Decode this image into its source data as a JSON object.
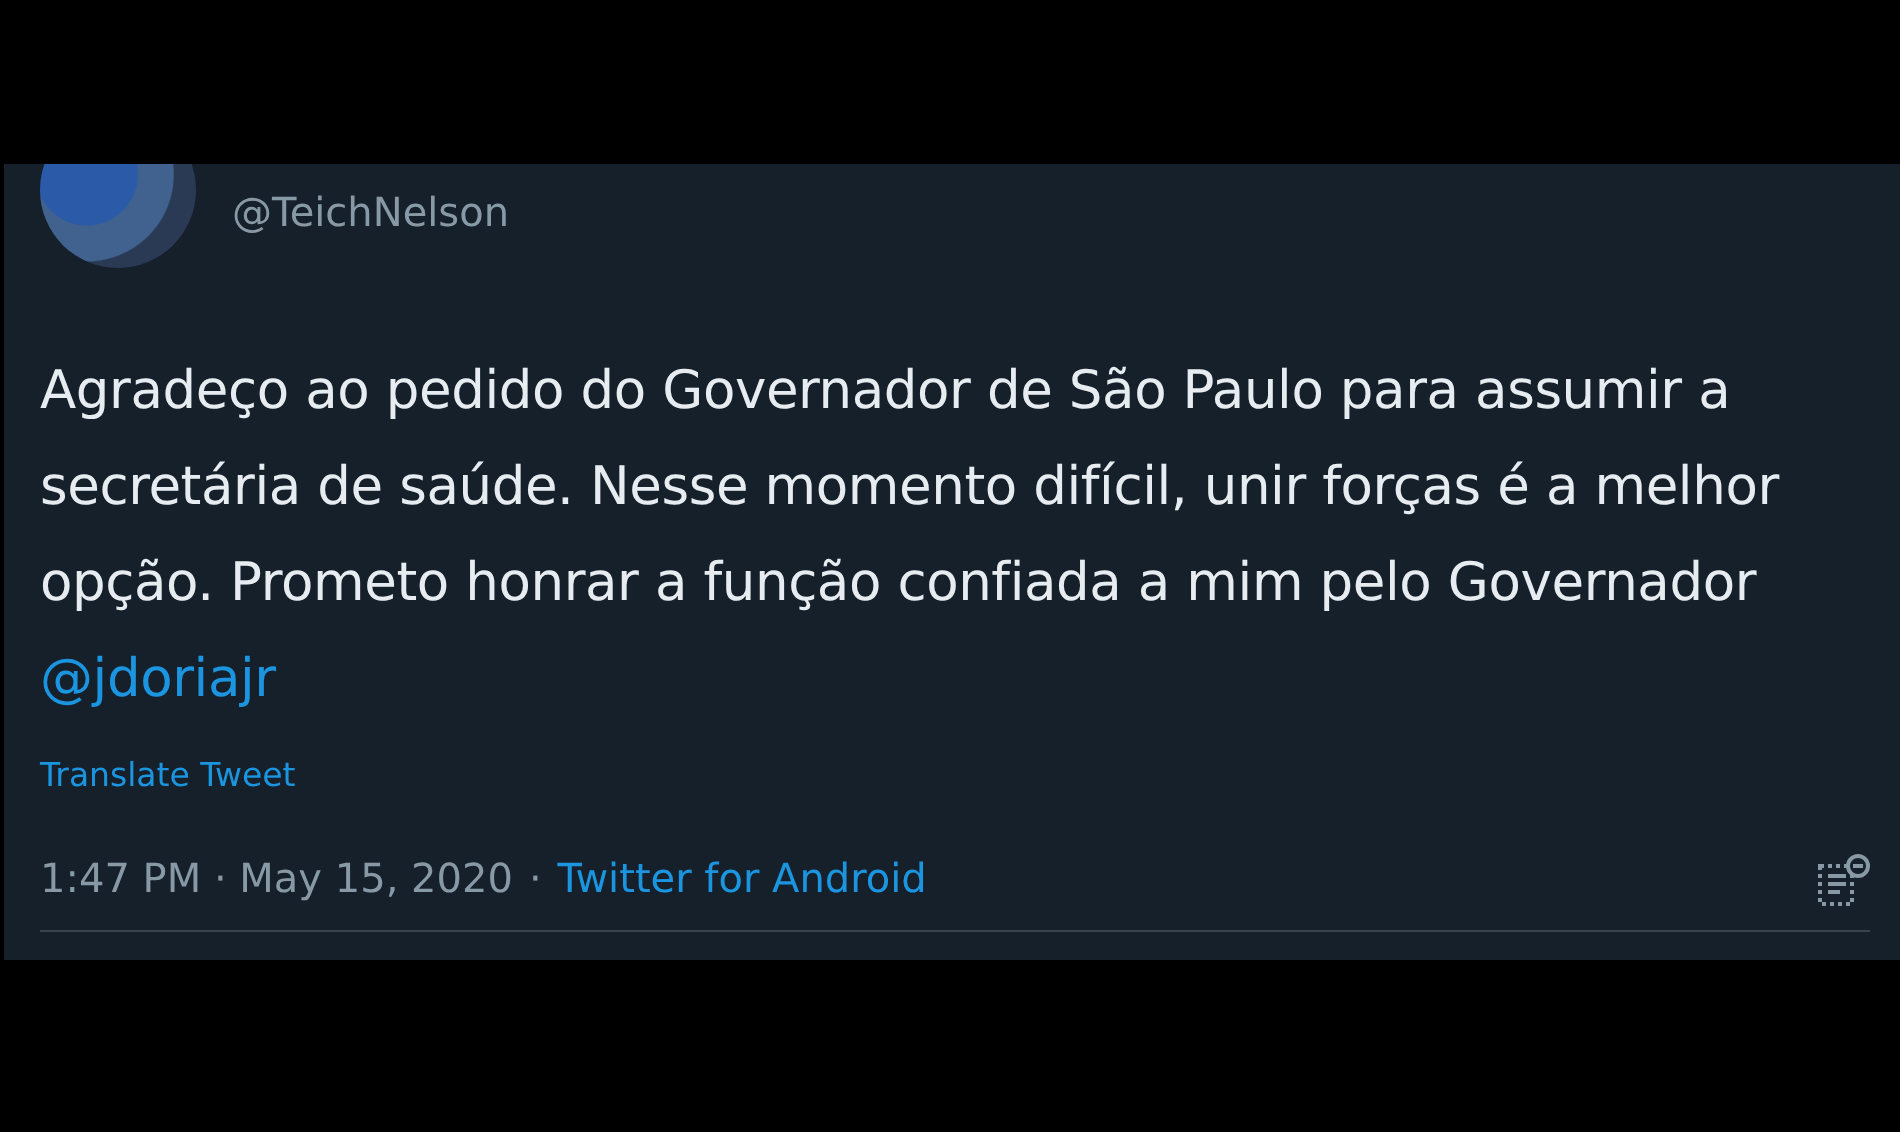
{
  "tweet": {
    "handle": "@TeichNelson",
    "text": "Agradeço ao pedido do Governador de São Paulo para assumir a secretária de saúde. Nesse momento difícil, unir forças é a melhor opção. Prometo honrar a função confiada a mim pelo Governador",
    "mention": "@jdoriajr",
    "translate": "Translate Tweet",
    "timestamp": "1:47 PM · May 15, 2020",
    "separator": "·",
    "source": "Twitter for Android"
  }
}
